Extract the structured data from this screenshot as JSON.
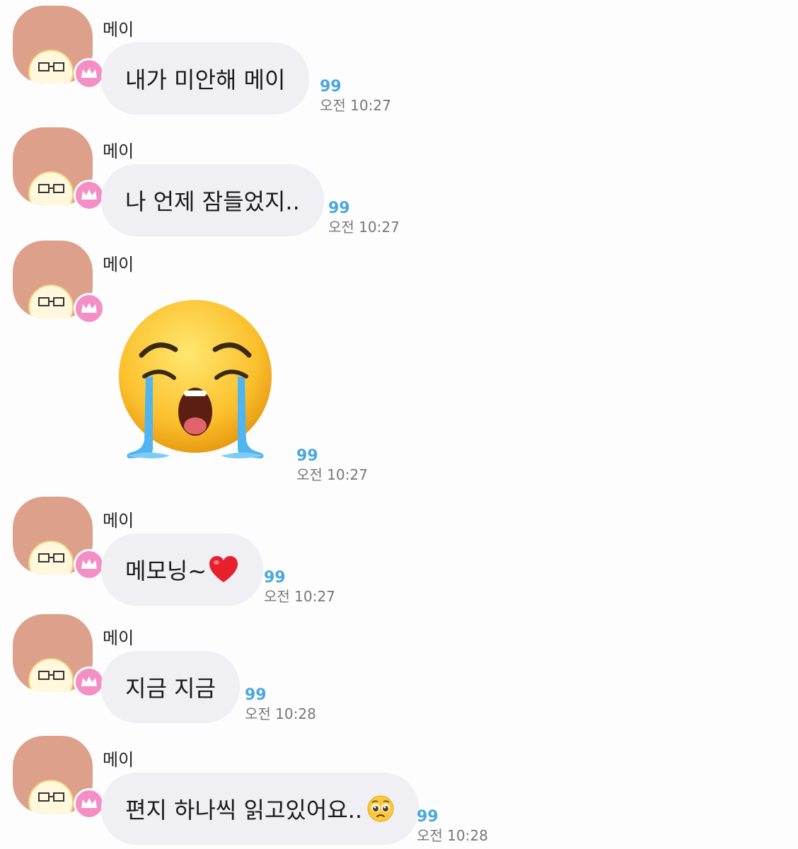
{
  "colors": {
    "background": "#fdfdfd",
    "bubble": "#efeff4",
    "read_count": "#4aa8dc",
    "avatar_bg": "#dca08b",
    "crown_badge": "#f48fc5"
  },
  "messages": [
    {
      "sender": "메이",
      "type": "text",
      "text": "내가 미안해 메이",
      "read": "99",
      "time": "오전 10:27"
    },
    {
      "sender": "메이",
      "type": "text",
      "text": "나 언제 잠들었지..",
      "read": "99",
      "time": "오전 10:27"
    },
    {
      "sender": "메이",
      "type": "emoji",
      "emoji": "loudly-crying-face",
      "read": "99",
      "time": "오전 10:27"
    },
    {
      "sender": "메이",
      "type": "text",
      "text": "메모닝~",
      "trailing_emoji": "red-heart",
      "read": "99",
      "time": "오전 10:27"
    },
    {
      "sender": "메이",
      "type": "text",
      "text": "지금 지금",
      "read": "99",
      "time": "오전 10:28"
    },
    {
      "sender": "메이",
      "type": "text",
      "text": "편지 하나씩 읽고있어요..",
      "trailing_emoji": "pleading-face",
      "read": "99",
      "time": "오전 10:28"
    }
  ]
}
